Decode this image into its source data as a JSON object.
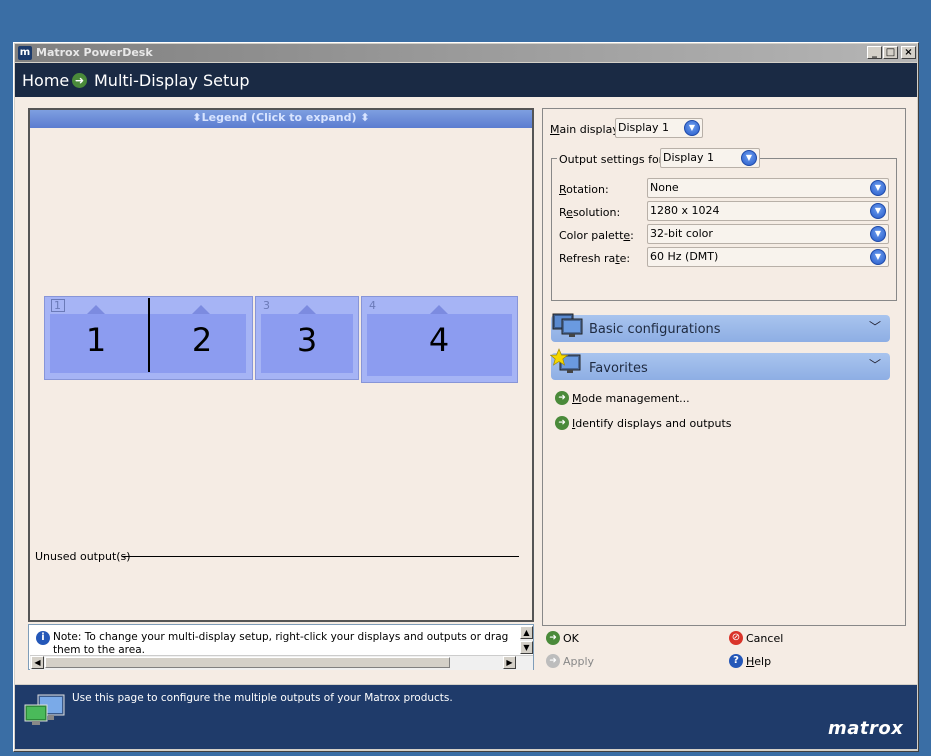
{
  "window": {
    "title": "Matrox PowerDesk",
    "icon_letter": "m",
    "controls": {
      "minimize": "_",
      "maximize": "□",
      "close": "×"
    }
  },
  "breadcrumb": {
    "home": "Home",
    "page": "Multi-Display Setup"
  },
  "layout": {
    "legend_label": "⬍Legend (Click to expand) ⬍",
    "displays": [
      {
        "index": "1",
        "small_label": "1",
        "label": "1"
      },
      {
        "index": "2",
        "small_label": "",
        "label": "2"
      },
      {
        "index": "3",
        "small_label": "3",
        "label": "3"
      },
      {
        "index": "4",
        "small_label": "4",
        "label": "4"
      }
    ],
    "unused_outputs_label": "Unused output(s)"
  },
  "note": {
    "text": "Note: To change your multi-display setup, right-click your displays and outputs or drag them to the area."
  },
  "settings": {
    "main_display": {
      "label_u": "M",
      "label_rest": "ain display:",
      "value": "Display 1"
    },
    "output_settings": {
      "label": "Output settings for:",
      "value": "Display 1"
    },
    "rows": [
      {
        "label_u": "R",
        "label_rest": "otation:",
        "value": "None"
      },
      {
        "label_pre": "R",
        "label_u": "e",
        "label_rest": "solution:",
        "value": "1280 x 1024"
      },
      {
        "label_pre": "Color palett",
        "label_u": "e",
        "label_rest": ":",
        "value": "32-bit color"
      },
      {
        "label_pre": "Refresh ra",
        "label_u": "t",
        "label_rest": "e:",
        "value": "60 Hz (DMT)"
      }
    ],
    "sections": [
      {
        "title": "Basic configurations",
        "icon": "monitors-icon"
      },
      {
        "title": "Favorites",
        "icon": "star-monitor-icon"
      }
    ],
    "links": [
      {
        "label_u": "M",
        "label_rest": "ode management..."
      },
      {
        "label_u": "I",
        "label_rest": "dentify displays and outputs"
      }
    ]
  },
  "buttons": {
    "ok": "OK",
    "cancel": "Cancel",
    "apply": "Apply",
    "help_u": "H",
    "help_rest": "elp"
  },
  "footer": {
    "text": "Use this page to configure the multiple outputs of your Matrox products.",
    "brand": "matrox"
  },
  "colors": {
    "desktop": "#3a6ea5",
    "header": "#1a2a44",
    "footer": "#1f3b6a",
    "display_tile": "#a6b4f5",
    "section_bar": "#9db8ea"
  }
}
